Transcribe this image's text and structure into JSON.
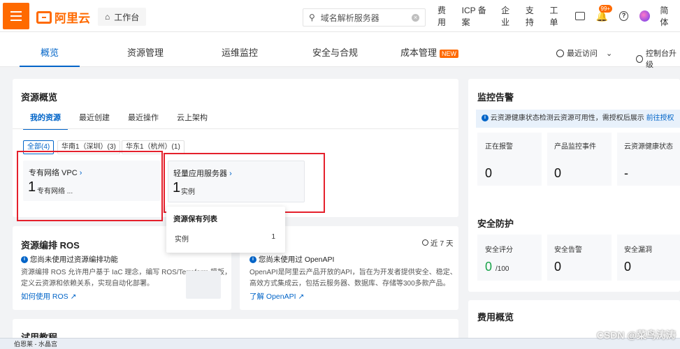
{
  "topbar": {
    "logo_text": "阿里云",
    "workspace_label": "工作台",
    "search_placeholder": "域名解析服务器",
    "links": [
      "费用",
      "ICP 备案",
      "企业",
      "支持",
      "工单"
    ],
    "notification_count": "99+",
    "lang_label": "简体"
  },
  "nav": {
    "tabs": [
      "概览",
      "资源管理",
      "运维监控",
      "安全与合规",
      "成本管理"
    ],
    "new_badge": "NEW",
    "recent_label": "最近访问",
    "console_upgrade_label": "控制台升级"
  },
  "resource_overview": {
    "title": "资源概览",
    "subtabs": [
      "我的资源",
      "最近创建",
      "最近操作",
      "云上架构"
    ],
    "chips": [
      "全部(4)",
      "华南1（深圳）(3)",
      "华东1（杭州）(1)"
    ],
    "items": [
      {
        "title": "专有网络 VPC",
        "count": "1",
        "unit": "专有网络 ..."
      },
      {
        "title": "轻量应用服务器",
        "count": "1",
        "unit": "实例"
      }
    ],
    "popover": {
      "title": "资源保有列表",
      "row_label": "实例",
      "row_value": "1"
    }
  },
  "ros": {
    "title": "资源编排 ROS",
    "notice": "您尚未使用过资源编排功能",
    "desc1": "资源编排 ROS 允许用户基于 IaC 理念，编写 ROS/Terraform 模板，",
    "desc2": "定义云资源和依赖关系，实现自动化部署。",
    "link": "如何使用 ROS"
  },
  "openapi": {
    "period": "近 7 天",
    "notice": "您尚未使用过 OpenAPI",
    "desc1": "OpenAPI是阿里云产品开放的API，旨在为开发者提供安全、稳定、",
    "desc2": "高效方式集成云，包括云服务器、数据库、存储等300多款产品。",
    "link": "了解 OpenAPI"
  },
  "trial": {
    "title": "试用教程"
  },
  "monitor": {
    "title": "监控告警",
    "banner": "云资源健康状态检测云资源可用性，需授权后展示",
    "banner_link": "前往授权",
    "cells": [
      {
        "label": "正在报警",
        "value": "0"
      },
      {
        "label": "产品监控事件",
        "value": "0"
      },
      {
        "label": "云资源健康状态",
        "value": "-"
      }
    ]
  },
  "security": {
    "title": "安全防护",
    "cells": [
      {
        "label": "安全评分",
        "value": "0",
        "suffix": "/100"
      },
      {
        "label": "安全告警",
        "value": "0"
      },
      {
        "label": "安全漏洞",
        "value": "0"
      }
    ]
  },
  "cost": {
    "title": "费用概览"
  },
  "taskbar": {
    "item": "伯恩莱 - 水晶宫"
  },
  "watermark": "CSDN @菜鸟涛涛",
  "colors": {
    "brand": "#ff6a00",
    "primary": "#0064c8",
    "highlight": "#e5202c"
  }
}
